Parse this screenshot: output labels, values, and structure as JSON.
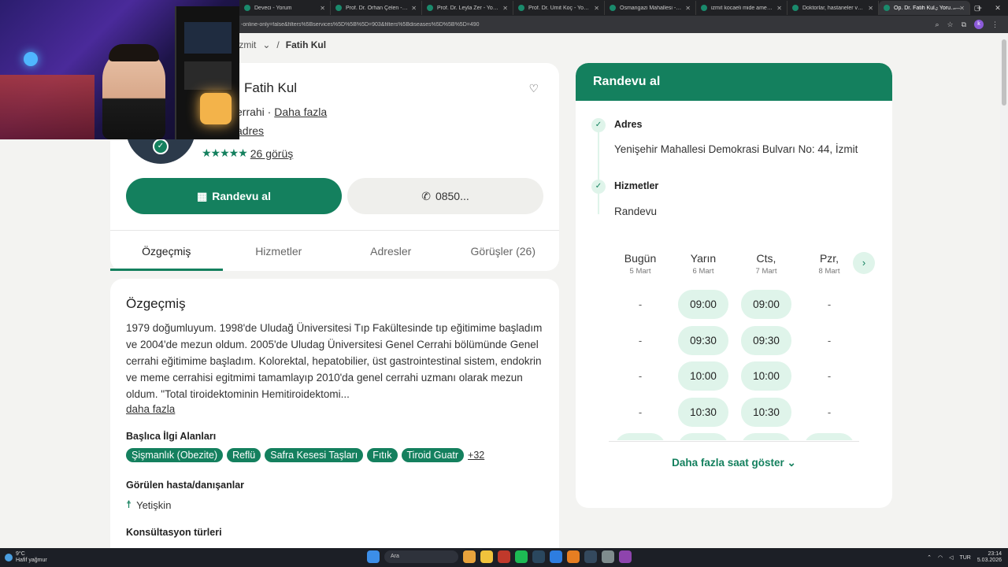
{
  "browser": {
    "tabs": [
      {
        "title": "Deveci - Yorum",
        "active": false
      },
      {
        "title": "Prof. Dr. Orhan Çelen - Yorum",
        "active": false
      },
      {
        "title": "Prof. Dr. Leyla Zer - Yorumlar",
        "active": false
      },
      {
        "title": "Prof. Dr. Ümit Koç - Yorumlar",
        "active": false
      },
      {
        "title": "Osmangazi Mahallesi - Google",
        "active": false
      },
      {
        "title": "izmit kocaeli mide ameliyatı",
        "active": false
      },
      {
        "title": "Doktorlar, hastaneler ve tüm",
        "active": false
      },
      {
        "title": "Op. Dr. Fatih Kul - Yorumları",
        "active": true
      }
    ],
    "new_tab": "+",
    "url": "-online-only=false&filters%5Bservices%5D%5B%5D=903&filters%5Bdiseases%5D%5B%5D=490"
  },
  "breadcrumb": {
    "city": "İzmit",
    "current": "Fatih Kul"
  },
  "profile": {
    "name": "Fatih Kul",
    "specialty": "errahi ·",
    "more_link": "Daha fazla",
    "address_link": "adres",
    "stars": "★★★★★",
    "reviews_link": "26 görüş",
    "book_button": "Randevu al",
    "phone_button": "0850...",
    "tabs": [
      "Özgeçmiş",
      "Hizmetler",
      "Adresler",
      "Görüşler (26)"
    ]
  },
  "bio": {
    "title": "Özgeçmiş",
    "text": "1979 doğumluyum. 1998'de Uludağ Üniversitesi Tıp Fakültesinde tıp eğitimime başladım ve 2004'de mezun oldum. 2005'de Uludag Üniversitesi Genel Cerrahi bölümünde Genel cerrahi eğitimime başladım. Kolorektal, hepatobilier, üst gastrointestinal sistem, endokrin ve meme cerrahisi egitmimi tamamlayıp 2010'da genel cerrahi uzmanı olarak mezun oldum. \"Total tiroidektominin Hemitiroidektomi...",
    "more": "daha fazla",
    "interests_title": "Başlıca İlgi Alanları",
    "interests": [
      "Şişmanlık (Obezite)",
      "Reflü",
      "Safra Kesesi Taşları",
      "Fıtık",
      "Tiroid Guatr"
    ],
    "interests_more": "+32",
    "patients_title": "Görülen hasta/danışanlar",
    "patients": "Yetişkin",
    "consult_title": "Konsültasyon türleri"
  },
  "appointment": {
    "title": "Randevu al",
    "address_label": "Adres",
    "address_value": "Yenişehir Mahallesi Demokrasi Bulvarı No: 44, İzmit",
    "services_label": "Hizmetler",
    "services_value": "Randevu",
    "days": [
      {
        "name": "Bugün",
        "date": "5 Mart"
      },
      {
        "name": "Yarın",
        "date": "6 Mart"
      },
      {
        "name": "Cts,",
        "date": "7 Mart"
      },
      {
        "name": "Pzr,",
        "date": "8 Mart"
      }
    ],
    "slots": [
      [
        "-",
        "09:00",
        "09:00",
        "-"
      ],
      [
        "-",
        "09:30",
        "09:30",
        "-"
      ],
      [
        "-",
        "10:00",
        "10:00",
        "-"
      ],
      [
        "-",
        "10:30",
        "10:30",
        "-"
      ],
      [
        "",
        "",
        "",
        ""
      ]
    ],
    "more_hours": "Daha fazla saat göster"
  },
  "taskbar": {
    "weather_temp": "9°C",
    "weather_desc": "Hafif yağmur",
    "search": "Ara",
    "lang": "TUR",
    "time": "23:14",
    "date": "5.03.2026"
  },
  "colors": {
    "brand": "#14805e",
    "slot_bg": "#dff4ea"
  }
}
